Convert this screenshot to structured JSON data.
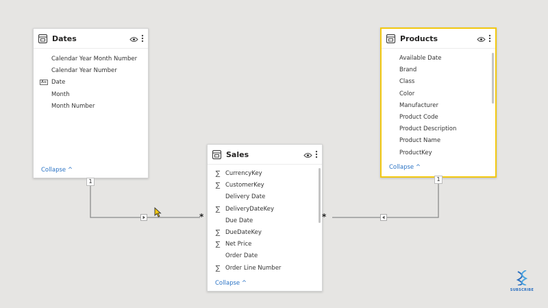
{
  "tables": {
    "dates": {
      "title": "Dates",
      "fields": [
        {
          "label": "Calendar Year Month Number",
          "icon": "none"
        },
        {
          "label": "Calendar Year Number",
          "icon": "none"
        },
        {
          "label": "Date",
          "icon": "calendar-icon"
        },
        {
          "label": "Month",
          "icon": "none"
        },
        {
          "label": "Month Number",
          "icon": "none"
        }
      ],
      "collapse_label": "Collapse"
    },
    "products": {
      "title": "Products",
      "fields": [
        {
          "label": "Available Date",
          "icon": "none"
        },
        {
          "label": "Brand",
          "icon": "none"
        },
        {
          "label": "Class",
          "icon": "none"
        },
        {
          "label": "Color",
          "icon": "none"
        },
        {
          "label": "Manufacturer",
          "icon": "none"
        },
        {
          "label": "Product Code",
          "icon": "none"
        },
        {
          "label": "Product Description",
          "icon": "none"
        },
        {
          "label": "Product Name",
          "icon": "none"
        },
        {
          "label": "ProductKey",
          "icon": "none"
        }
      ],
      "collapse_label": "Collapse"
    },
    "sales": {
      "title": "Sales",
      "fields": [
        {
          "label": "CurrencyKey",
          "icon": "sigma-icon"
        },
        {
          "label": "CustomerKey",
          "icon": "sigma-icon"
        },
        {
          "label": "Delivery Date",
          "icon": "none"
        },
        {
          "label": "DeliveryDateKey",
          "icon": "sigma-icon"
        },
        {
          "label": "Due Date",
          "icon": "none"
        },
        {
          "label": "DueDateKey",
          "icon": "sigma-icon"
        },
        {
          "label": "Net Price",
          "icon": "sigma-icon"
        },
        {
          "label": "Order Date",
          "icon": "none"
        },
        {
          "label": "Order Line Number",
          "icon": "sigma-icon"
        }
      ],
      "collapse_label": "Collapse"
    }
  },
  "relationships": {
    "one_label": "1",
    "many_label": "*"
  },
  "logo": {
    "text": "SUBSCRIBE"
  },
  "colors": {
    "selected_border": "#f2c811",
    "link": "#2a73c5"
  }
}
